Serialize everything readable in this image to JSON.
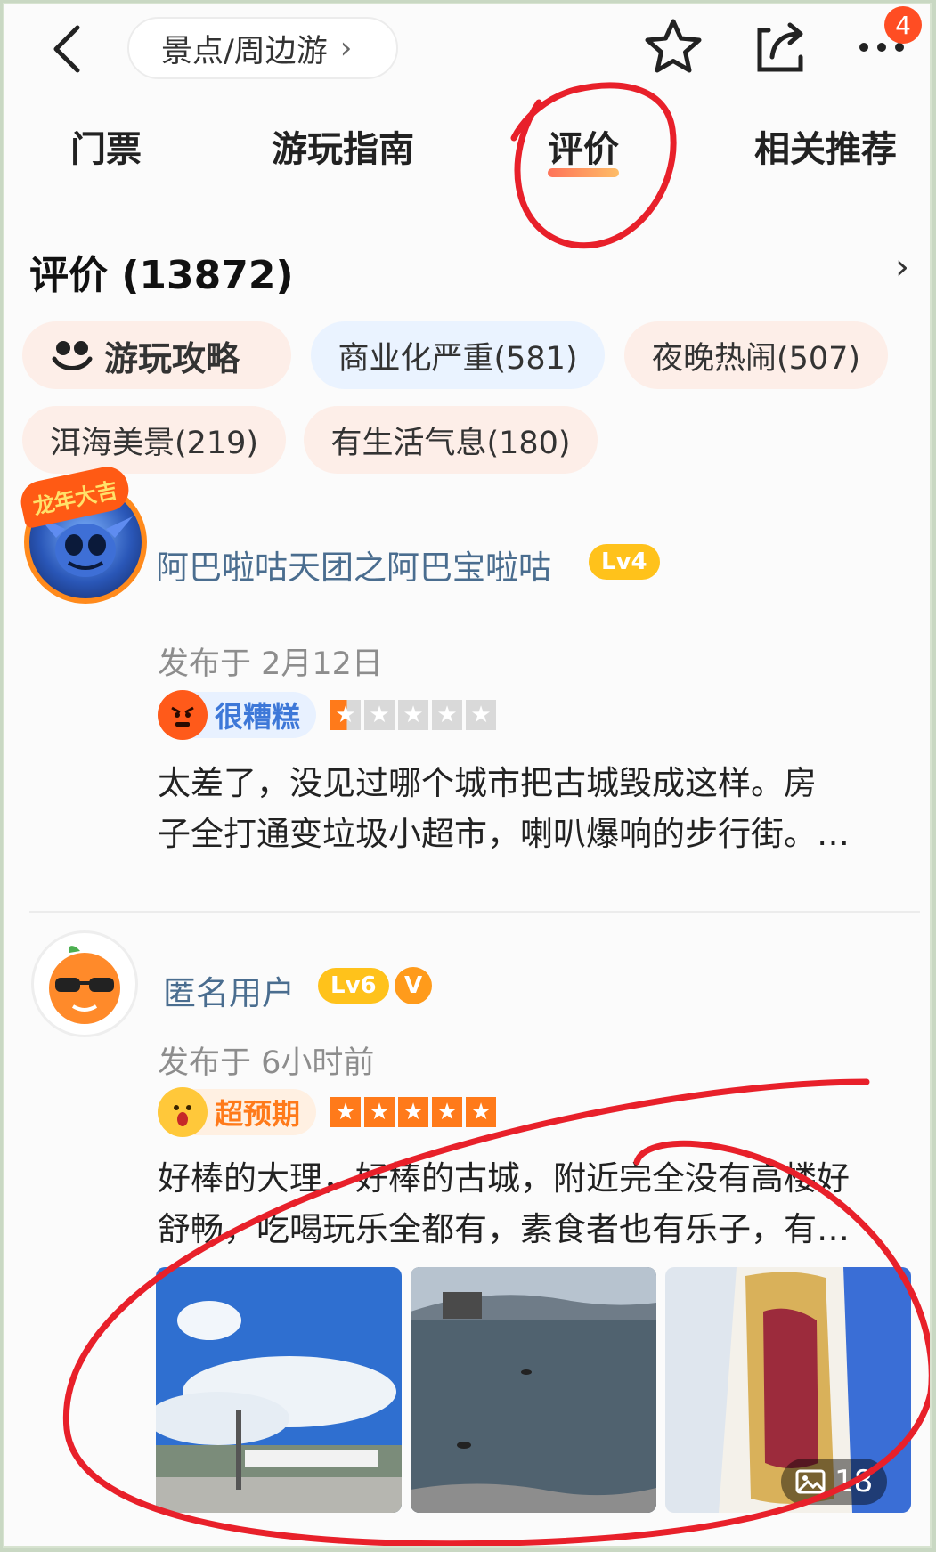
{
  "header": {
    "location_label": "景点/周边游",
    "notification_count": "4"
  },
  "tabs": [
    {
      "label": "门票"
    },
    {
      "label": "游玩指南"
    },
    {
      "label": "评价"
    },
    {
      "label": "相关推荐"
    }
  ],
  "reviews_section": {
    "title": "评价 (13872)"
  },
  "tags": [
    {
      "label": "游玩攻略"
    },
    {
      "label": "商业化严重(581)"
    },
    {
      "label": "夜晚热闹(507)"
    },
    {
      "label": "洱海美景(219)"
    },
    {
      "label": "有生活气息(180)"
    }
  ],
  "reviews": [
    {
      "avatar_tag": "龙年大吉",
      "username": "阿巴啦咕天团之阿巴宝啦咕",
      "level": "Lv4",
      "date": "发布于 2月12日",
      "rating_label": "很糟糕",
      "rating_stars": 1,
      "line1": "太差了，没见过哪个城市把古城毁成这样。房",
      "line2": "子全打通变垃圾小超市，喇叭爆响的步行街。…"
    },
    {
      "username": "匿名用户",
      "level": "Lv6",
      "verified_label": "V",
      "date": "发布于 6小时前",
      "rating_label": "超预期",
      "rating_stars": 5,
      "line1": "好棒的大理，好棒的古城，附近完全没有高楼好",
      "line2": "舒畅，吃喝玩乐全都有，素食者也有乐子，有…",
      "photo_count": "18"
    }
  ],
  "colors": {
    "accent": "#ff6a1f",
    "annotation_red": "#e8202a",
    "level_badge": "#ffc21b"
  }
}
